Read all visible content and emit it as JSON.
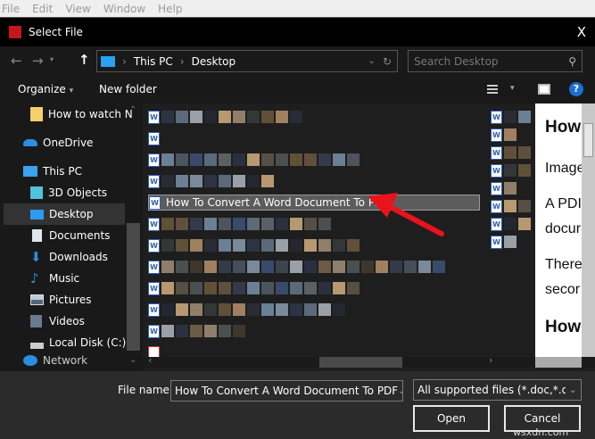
{
  "menubar": [
    "File",
    "Edit",
    "View",
    "Window",
    "Help"
  ],
  "dialog": {
    "title": "Select File",
    "close": "X"
  },
  "nav": {
    "breadcrumb": [
      "This PC",
      "Desktop"
    ],
    "search_placeholder": "Search Desktop"
  },
  "toolbar": {
    "organize": "Organize",
    "new_folder": "New folder",
    "help": "?"
  },
  "sidebar": {
    "items": [
      {
        "label": "How to watch N",
        "icon": "folder-icon"
      },
      {
        "label": "OneDrive",
        "icon": "cloud-icon"
      },
      {
        "label": "This PC",
        "icon": "computer-icon"
      },
      {
        "label": "3D Objects",
        "icon": "cube-icon"
      },
      {
        "label": "Desktop",
        "icon": "desktop-icon",
        "selected": true
      },
      {
        "label": "Documents",
        "icon": "document-icon"
      },
      {
        "label": "Downloads",
        "icon": "download-icon"
      },
      {
        "label": "Music",
        "icon": "music-icon"
      },
      {
        "label": "Pictures",
        "icon": "pictures-icon"
      },
      {
        "label": "Videos",
        "icon": "videos-icon"
      },
      {
        "label": "Local Disk (C:)",
        "icon": "disk-icon"
      },
      {
        "label": "Network",
        "icon": "network-icon"
      }
    ]
  },
  "files": {
    "selected": "How To Convert A Word Document To PDF"
  },
  "preview": {
    "lines": [
      "How",
      "Image",
      "A PDI",
      "docur",
      "There",
      "secor",
      "How"
    ]
  },
  "bottom": {
    "file_name_label": "File name:",
    "file_name_value": "How To Convert A Word Document To PDF",
    "file_type": "All supported files (*.doc,*.docx",
    "open": "Open",
    "cancel": "Cancel"
  },
  "watermark": "wsxdn.com",
  "colors": {
    "accent": "#1e90ff",
    "arrow": "#e8131b"
  }
}
